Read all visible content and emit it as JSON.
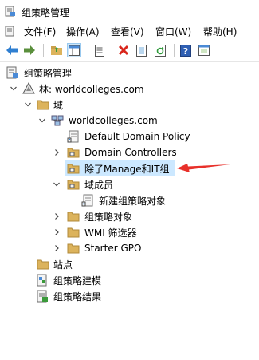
{
  "window": {
    "title": "组策略管理",
    "app_icon": "gpmc-icon"
  },
  "menu": [
    {
      "label": "文件(F)"
    },
    {
      "label": "操作(A)"
    },
    {
      "label": "查看(V)"
    },
    {
      "label": "窗口(W)"
    },
    {
      "label": "帮助(H)"
    }
  ],
  "toolbar": {
    "buttons": [
      "back-icon",
      "forward-icon",
      "up-folder-icon",
      "show-hide-tree-icon",
      "properties-icon",
      "delete-icon",
      "export-list-icon",
      "refresh-icon",
      "help-icon",
      "console-icon"
    ],
    "pressed": "show-hide-tree-icon"
  },
  "tree": {
    "root": "组策略管理",
    "forest": "林: worldcolleges.com",
    "domains": "域",
    "domain": "worldcolleges.com",
    "default_policy": "Default Domain Policy",
    "domain_controllers": "Domain Controllers",
    "selected_ou": "除了Manage和IT组",
    "member_ou": "域成员",
    "new_gpo": "新建组策略对象",
    "gpo_objects": "组策略对象",
    "wmi_filters": "WMI 筛选器",
    "starter_gpo": "Starter GPO",
    "sites": "站点",
    "modeling": "组策略建模",
    "results": "组策略结果"
  },
  "colors": {
    "selection": "#cce8ff",
    "annotation_arrow": "#e8302a",
    "folder": "#dcb35c"
  }
}
